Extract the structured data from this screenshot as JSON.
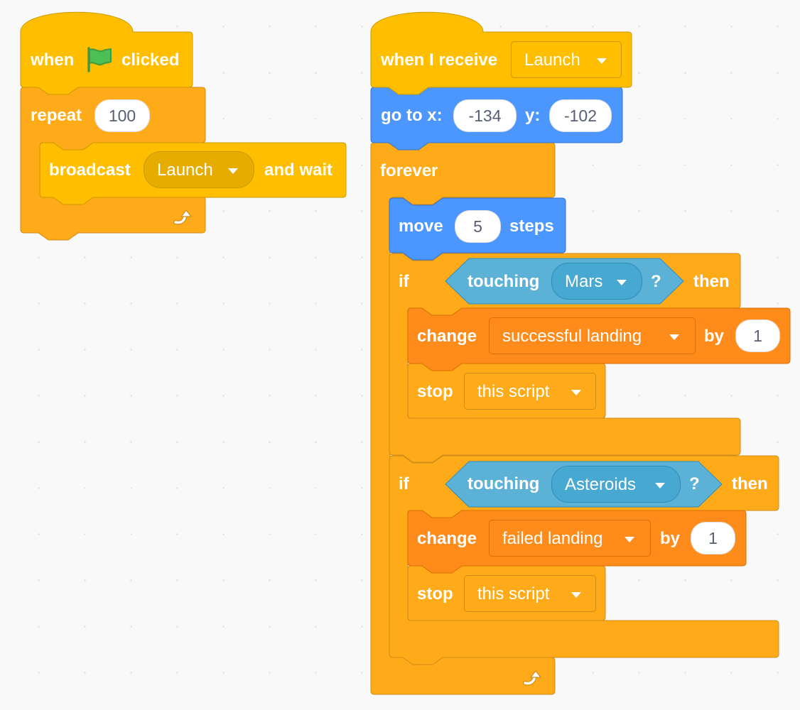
{
  "colors": {
    "events": "#ffbf00",
    "events_dark": "#cc9900",
    "control": "#ffab19",
    "control_dark": "#cf8b17",
    "motion": "#4c97ff",
    "motion_dark": "#3373cc",
    "sensing": "#5cb1d6",
    "sensing_dark": "#2e8eb8",
    "variables": "#ff8c1a",
    "variables_dark": "#db6e00",
    "input_text": "#575e75"
  },
  "script1": {
    "hat": {
      "when": "when",
      "flag_icon": "green-flag-icon",
      "clicked": "clicked"
    },
    "repeat": {
      "label": "repeat",
      "count": "100",
      "loop_icon": "loop-arrow-icon"
    },
    "broadcast": {
      "label": "broadcast",
      "message": "Launch",
      "suffix": "and wait"
    }
  },
  "script2": {
    "hat": {
      "label": "when I receive",
      "message": "Launch"
    },
    "goto": {
      "label": "go to x:",
      "x": "-134",
      "y_label": "y:",
      "y": "-102"
    },
    "forever": {
      "label": "forever",
      "loop_icon": "loop-arrow-icon"
    },
    "move": {
      "label": "move",
      "steps": "5",
      "suffix": "steps"
    },
    "if1": {
      "if": "if",
      "then": "then",
      "touching": "touching",
      "target": "Mars",
      "question": "?",
      "change": {
        "label": "change",
        "variable": "successful landing",
        "by": "by",
        "value": "1"
      },
      "stop": {
        "label": "stop",
        "option": "this script"
      }
    },
    "if2": {
      "if": "if",
      "then": "then",
      "touching": "touching",
      "target": "Asteroids",
      "question": "?",
      "change": {
        "label": "change",
        "variable": "failed landing",
        "by": "by",
        "value": "1"
      },
      "stop": {
        "label": "stop",
        "option": "this script"
      }
    }
  }
}
